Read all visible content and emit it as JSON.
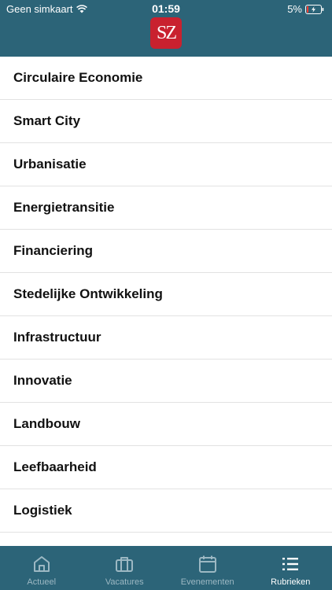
{
  "status_bar": {
    "carrier": "Geen simkaart",
    "time": "01:59",
    "battery": "5%"
  },
  "logo": {
    "text": "SZ"
  },
  "categories": [
    "Circulaire Economie",
    "Smart City",
    "Urbanisatie",
    "Energietransitie",
    "Financiering",
    "Stedelijke Ontwikkeling",
    "Infrastructuur",
    "Innovatie",
    "Landbouw",
    "Leefbaarheid",
    "Logistiek"
  ],
  "tabs": [
    {
      "label": "Actueel",
      "icon": "home-icon",
      "active": false
    },
    {
      "label": "Vacatures",
      "icon": "briefcase-icon",
      "active": false
    },
    {
      "label": "Evenementen",
      "icon": "calendar-icon",
      "active": false
    },
    {
      "label": "Rubrieken",
      "icon": "list-icon",
      "active": true
    }
  ],
  "colors": {
    "header": "#2c6478",
    "logo": "#c9212f",
    "tab_inactive": "#9cb8c3",
    "tab_active": "#ffffff"
  }
}
